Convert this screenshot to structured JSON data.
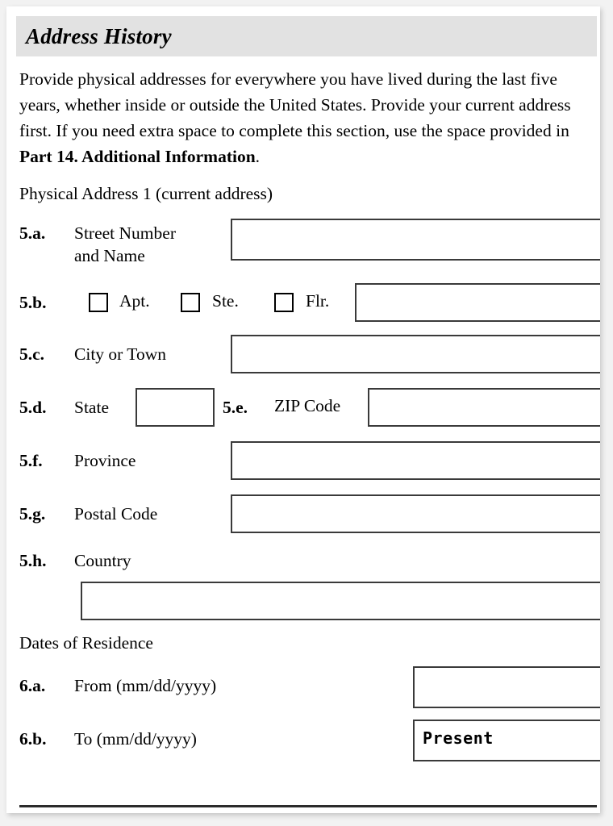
{
  "section": {
    "title": "Address History",
    "intro_line1": "Provide physical addresses for everywhere you have lived",
    "intro_line2": "during the last five years, whether inside or outside the United",
    "intro_line3": "States.  Provide your current address first.  If you need extra",
    "intro_line4": "space to complete this section, use the space provided in ",
    "intro_bold": "Part 14. Additional Information",
    "intro_end": ".",
    "subheading": "Physical Address 1 (current address)",
    "dates_heading": "Dates of Residence"
  },
  "fields": {
    "street": {
      "number": "5.a.",
      "label": "Street Number\nand Name",
      "value": ""
    },
    "unit": {
      "number": "5.b.",
      "checkbox_apt_label": "Apt.",
      "checkbox_ste_label": "Ste.",
      "checkbox_flr_label": "Flr.",
      "checkbox_apt_checked": false,
      "checkbox_ste_checked": false,
      "checkbox_flr_checked": false,
      "value": ""
    },
    "city": {
      "number": "5.c.",
      "label": "City or Town",
      "value": ""
    },
    "state": {
      "number": "5.d.",
      "label": "State",
      "value": ""
    },
    "zip": {
      "number": "5.e.",
      "label": "ZIP Code",
      "value": ""
    },
    "province": {
      "number": "5.f.",
      "label": "Province",
      "value": ""
    },
    "postal": {
      "number": "5.g.",
      "label": "Postal Code",
      "value": ""
    },
    "country": {
      "number": "5.h.",
      "label": "Country",
      "value": ""
    },
    "date_from": {
      "number": "6.a.",
      "label": "From (mm/dd/yyyy)",
      "value": ""
    },
    "date_to": {
      "number": "6.b.",
      "label": "To (mm/dd/yyyy)",
      "value": "Present"
    }
  },
  "colors": {
    "header_band": "#e2e2e2",
    "box_border": "#3a3a3a",
    "page_background": "#ffffff",
    "outer_background": "#f2f2f2"
  }
}
